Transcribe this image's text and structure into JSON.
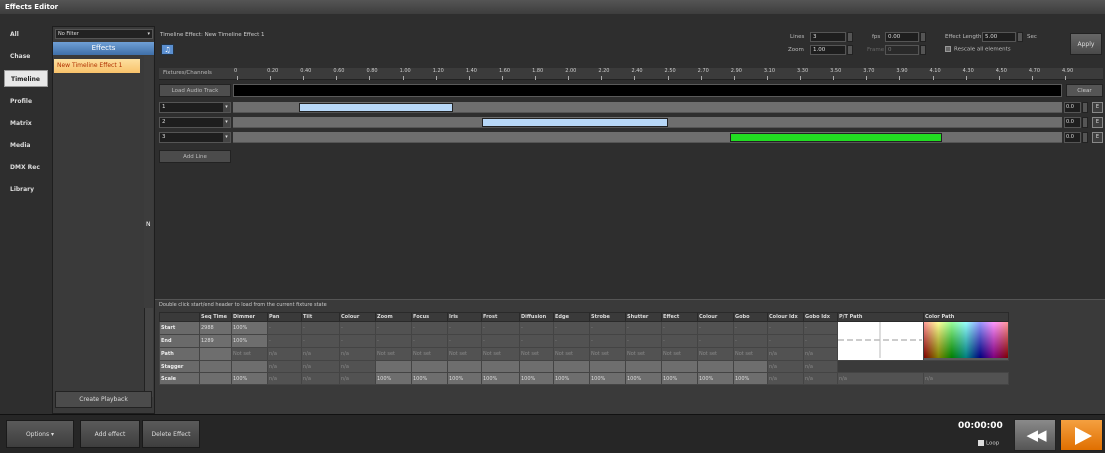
{
  "window_title": "Effects Editor",
  "nav": [
    {
      "label": "All",
      "active": false
    },
    {
      "label": "Chase",
      "active": false
    },
    {
      "label": "Timeline",
      "active": true
    },
    {
      "label": "Profile",
      "active": false
    },
    {
      "label": "Matrix",
      "active": false
    },
    {
      "label": "Media",
      "active": false
    },
    {
      "label": "DMX Rec",
      "active": false
    },
    {
      "label": "Library",
      "active": false
    }
  ],
  "effects_panel": {
    "filter": "No Filter",
    "header": "Effects",
    "selected_item": "New Timeline Effect 1",
    "create_playback": "Create Playback",
    "vertical_letter": "N"
  },
  "timeline": {
    "name_label": "Timeline Effect: New Timeline Effect 1",
    "lines_label": "Lines",
    "lines_value": "3",
    "zoom_label": "Zoom",
    "zoom_value": "1.00",
    "fps_label": "fps",
    "fps_value": "0.00",
    "frame_label": "Frame",
    "frame_value": "0",
    "length_label": "Effect Length",
    "length_value": "5.00",
    "length_unit": "Sec",
    "rescale_label": "Rescale all elements",
    "apply": "Apply",
    "fixtures_label": "Fixtures/Channels",
    "ruler_ticks": [
      "0",
      "0.20",
      "0.40",
      "0.60",
      "0.80",
      "1.00",
      "1.20",
      "1.40",
      "1.60",
      "1.80",
      "2.00",
      "2.20",
      "2.40",
      "2.50",
      "2.70",
      "2.90",
      "3.10",
      "3.30",
      "3.50",
      "3.70",
      "3.90",
      "4.10",
      "4.30",
      "4.50",
      "4.70",
      "4.90"
    ],
    "load_audio": "Load Audio Track",
    "clear": "Clear",
    "rows": [
      {
        "label": "1",
        "value": "0.0",
        "edit": "E",
        "block_start": 0.08,
        "block_end": 0.265,
        "color": "#b8d8f8"
      },
      {
        "label": "2",
        "value": "0.0",
        "edit": "E",
        "block_start": 0.3,
        "block_end": 0.525,
        "color": "#b8d8f8"
      },
      {
        "label": "3",
        "value": "0.0",
        "edit": "E",
        "block_start": 0.6,
        "block_end": 0.855,
        "color": "#22dd22"
      }
    ],
    "add_line": "Add Line"
  },
  "grid": {
    "hint": "Double click start/end header to load from the current fixture state",
    "columns": [
      "",
      "Seq Time",
      "Dimmer",
      "Pan",
      "Tilt",
      "Colour",
      "Zoom",
      "Focus",
      "Iris",
      "Frost",
      "Diffusion",
      "Edge",
      "Strobe",
      "Shutter",
      "Effect",
      "Colour",
      "Gobo",
      "Colour Idx",
      "Gobo Idx",
      "P/T Path",
      "Color Path"
    ],
    "rows": [
      {
        "head": "Start",
        "cells": [
          "2988",
          "100%",
          "-",
          "-",
          "-",
          "-",
          "-",
          "-",
          "-",
          "-",
          "-",
          "-",
          "-",
          "-",
          "-",
          "-",
          "-",
          "-"
        ]
      },
      {
        "head": "End",
        "cells": [
          "1289",
          "100%",
          "-",
          "-",
          "-",
          "-",
          "-",
          "-",
          "-",
          "-",
          "-",
          "-",
          "-",
          "-",
          "-",
          "-",
          "-",
          "-"
        ]
      },
      {
        "head": "Path",
        "cells": [
          "",
          "Not set",
          "n/a",
          "n/a",
          "n/a",
          "Not set",
          "Not set",
          "Not set",
          "Not set",
          "Not set",
          "Not set",
          "Not set",
          "Not set",
          "Not set",
          "Not set",
          "Not set",
          "n/a",
          "n/a"
        ]
      },
      {
        "head": "Stagger",
        "cells": [
          "",
          "",
          "n/a",
          "n/a",
          "n/a",
          "",
          "",
          "",
          "",
          "",
          "",
          "",
          "",
          "",
          "",
          "",
          "n/a",
          "n/a"
        ]
      },
      {
        "head": "Scale",
        "cells": [
          "",
          "100%",
          "n/a",
          "n/a",
          "n/a",
          "100%",
          "100%",
          "100%",
          "100%",
          "100%",
          "100%",
          "100%",
          "100%",
          "100%",
          "100%",
          "100%",
          "n/a",
          "n/a",
          "n/a",
          "n/a"
        ]
      }
    ]
  },
  "bottom": {
    "options": "Options",
    "add_effect": "Add effect",
    "delete_effect": "Delete Effect",
    "time": "00:00:00",
    "loop": "Loop"
  }
}
